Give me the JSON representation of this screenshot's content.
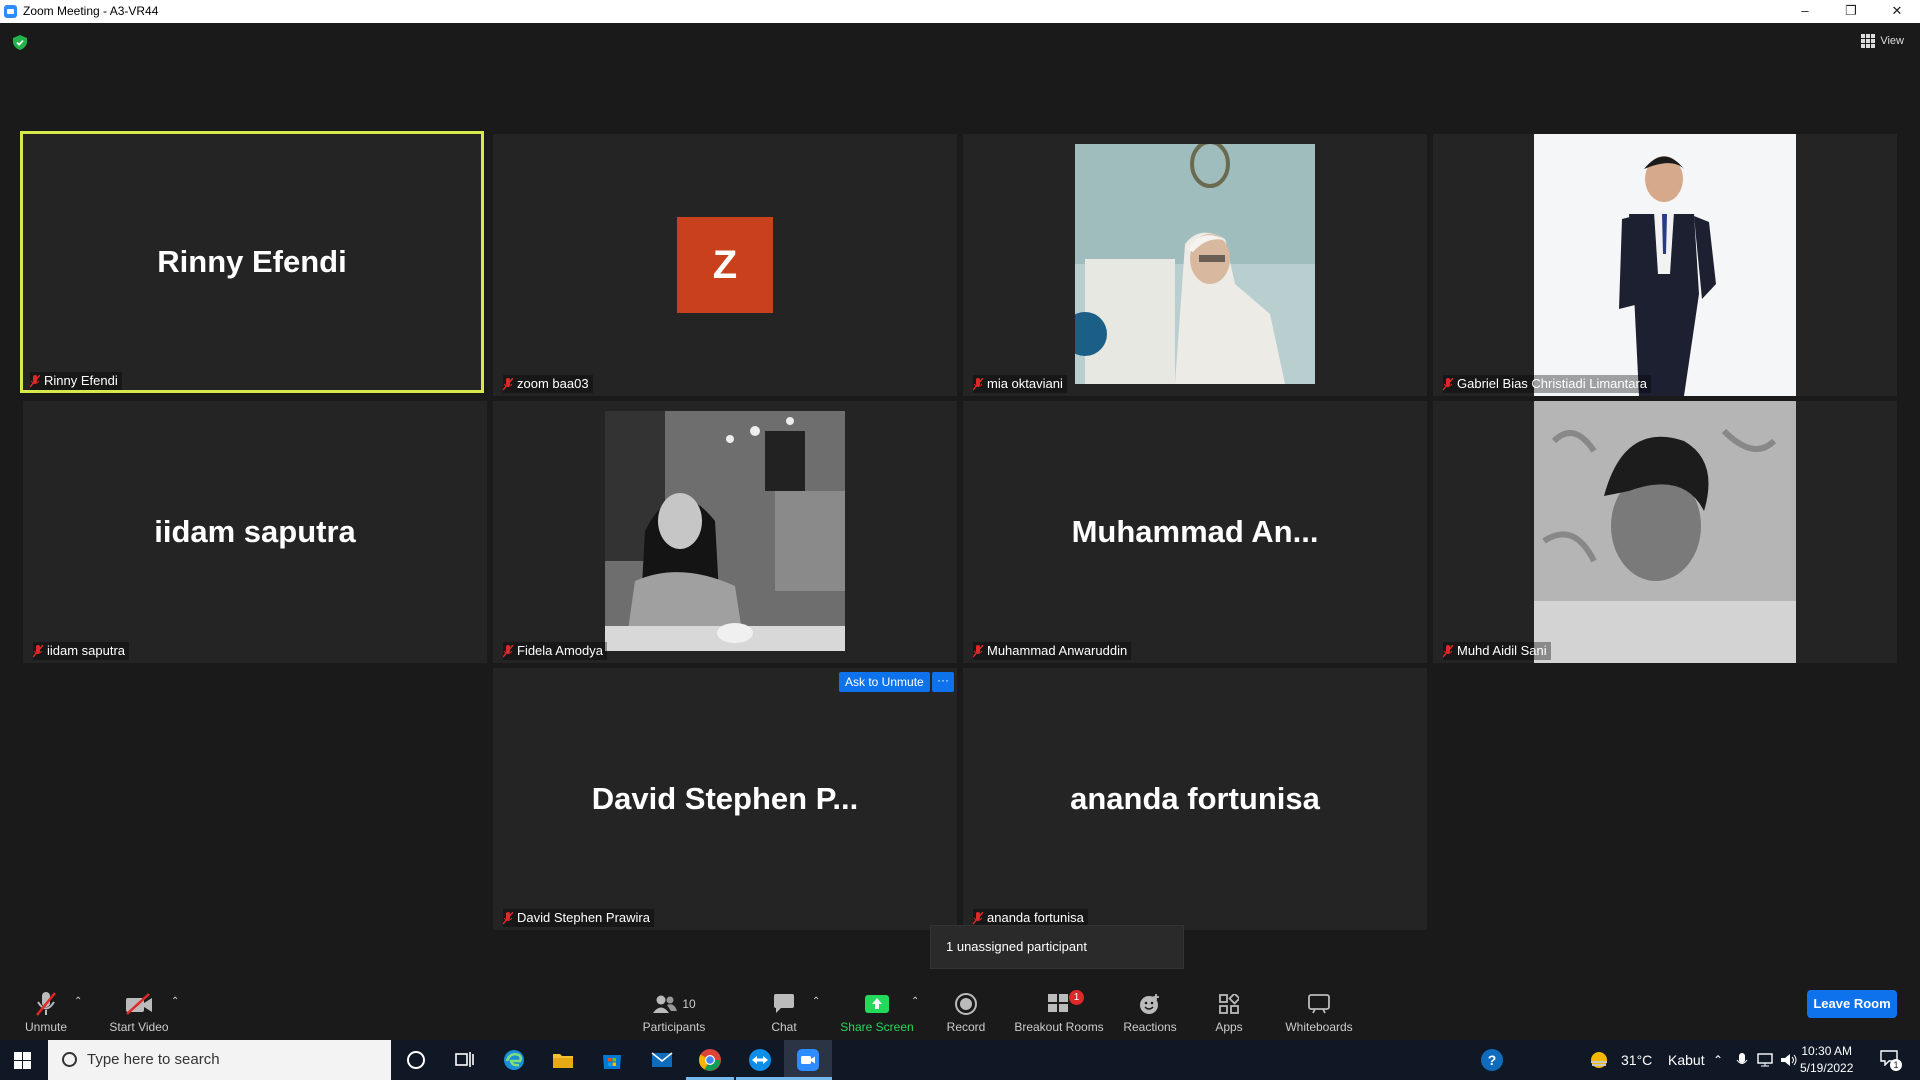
{
  "window": {
    "title": "Zoom Meeting - A3-VR44"
  },
  "topbar": {
    "view_label": "View"
  },
  "tiles": [
    {
      "display_name": "Rinny Efendi",
      "label": "Rinny Efendi",
      "active": true
    },
    {
      "avatar_letter": "Z",
      "label": "zoom baa03"
    },
    {
      "label": "mia oktaviani"
    },
    {
      "label": "Gabriel Bias Christiadi Limantara"
    },
    {
      "display_name": "iidam saputra",
      "label": "iidam saputra"
    },
    {
      "label": "Fidela Amodya"
    },
    {
      "display_name": "Muhammad  An...",
      "label": "Muhammad Anwaruddin"
    },
    {
      "label": "Muhd Aidil Sani"
    },
    {
      "display_name": "David  Stephen  P...",
      "label": "David Stephen Prawira"
    },
    {
      "display_name": "ananda fortunisa",
      "label": "ananda fortunisa"
    }
  ],
  "ask_to_unmute": {
    "label": "Ask to Unmute",
    "more": "···"
  },
  "unassigned_tooltip": "1 unassigned participant",
  "toolbar": {
    "unmute": "Unmute",
    "start_video": "Start Video",
    "participants": "Participants",
    "participants_count": "10",
    "chat": "Chat",
    "share_screen": "Share Screen",
    "record": "Record",
    "breakout_rooms": "Breakout Rooms",
    "breakout_badge": "1",
    "reactions": "Reactions",
    "apps": "Apps",
    "whiteboards": "Whiteboards",
    "leave": "Leave Room"
  },
  "taskbar": {
    "search_placeholder": "Type here to search",
    "weather_temp": "31°C",
    "weather_desc": "Kabut",
    "time": "10:30 AM",
    "date": "5/19/2022",
    "notification_count": "1"
  },
  "colors": {
    "active_speaker": "#d6e84a",
    "accent_blue": "#0e72ed",
    "share_green": "#23d959",
    "avatar_orange": "#c8411c"
  }
}
